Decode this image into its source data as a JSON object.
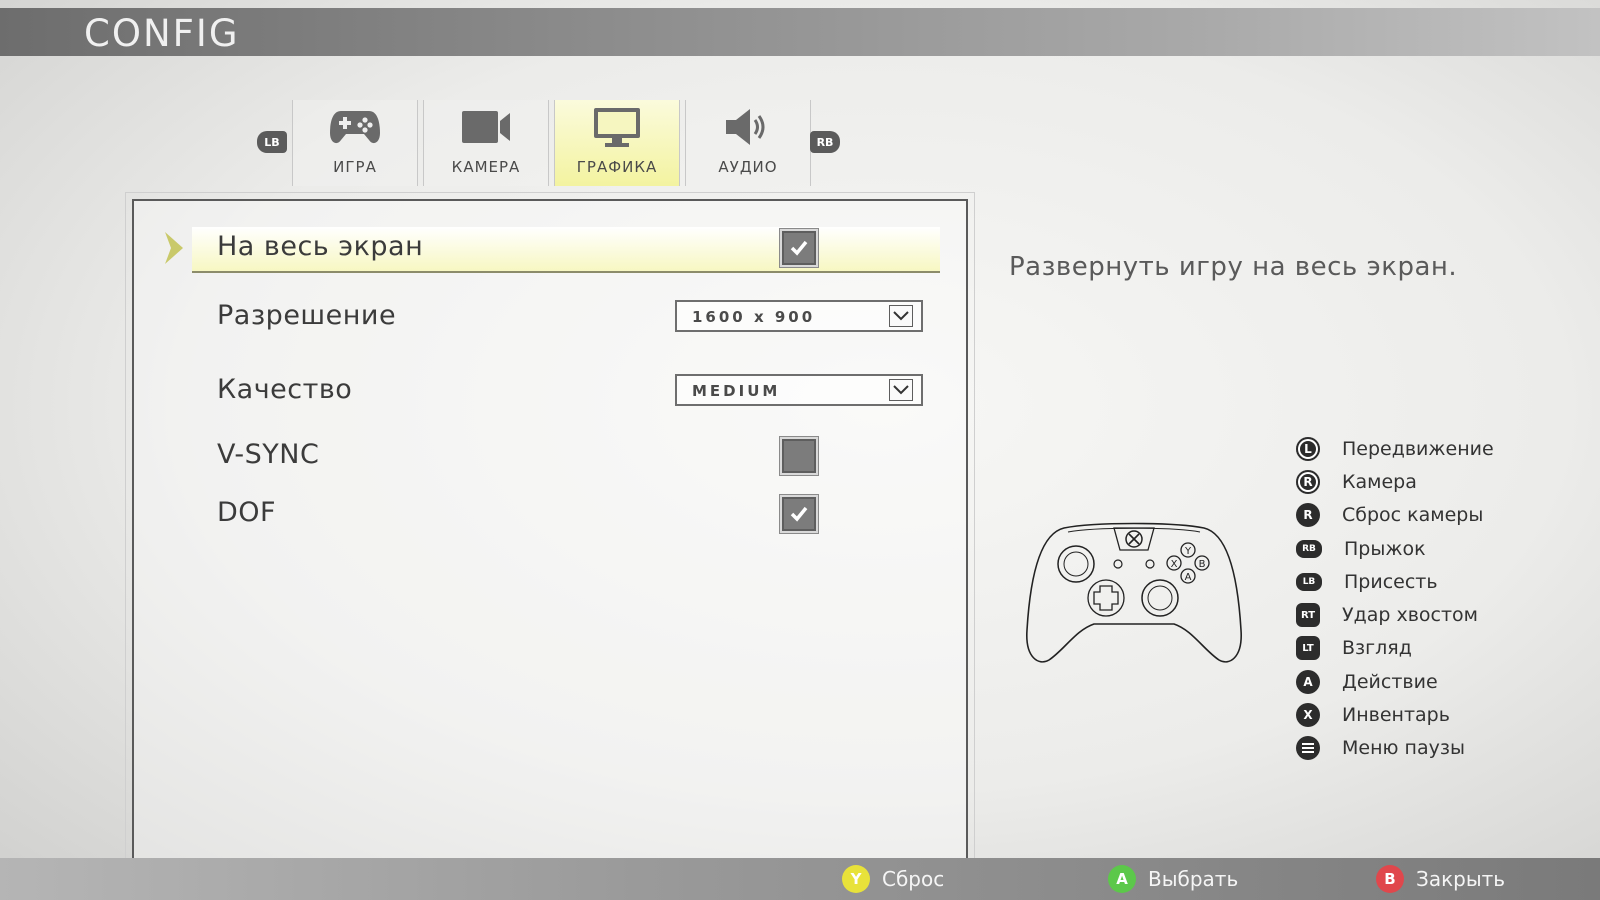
{
  "header": {
    "title": "CONFIG"
  },
  "tabs": {
    "lb": "LB",
    "rb": "RB",
    "items": [
      {
        "label": "ИГРА",
        "icon": "gamepad-icon"
      },
      {
        "label": "КАМЕРА",
        "icon": "camera-icon"
      },
      {
        "label": "ГРАФИКА",
        "icon": "monitor-icon"
      },
      {
        "label": "АУДИО",
        "icon": "speaker-icon"
      }
    ],
    "active": "ГРАФИКА"
  },
  "settings": {
    "fullscreen": {
      "label": "На весь экран",
      "checked": true
    },
    "resolution": {
      "label": "Разрешение",
      "value": "1600 x 900"
    },
    "quality": {
      "label": "Качество",
      "value": "MEDIUM"
    },
    "vsync": {
      "label": "V-SYNC",
      "checked": false
    },
    "dof": {
      "label": "DOF",
      "checked": true
    }
  },
  "description": "Развернуть игру на весь экран.",
  "controls": [
    {
      "button": "L",
      "label": "Передвижение"
    },
    {
      "button": "R",
      "label": "Камера"
    },
    {
      "button": "R",
      "label": "Сброс камеры"
    },
    {
      "button": "RB",
      "label": "Прыжок"
    },
    {
      "button": "LB",
      "label": "Присесть"
    },
    {
      "button": "RT",
      "label": "Удар хвостом"
    },
    {
      "button": "LT",
      "label": "Взгляд"
    },
    {
      "button": "A",
      "label": "Действие"
    },
    {
      "button": "X",
      "label": "Инвентарь"
    },
    {
      "button": "menu",
      "label": "Меню паузы"
    }
  ],
  "footer": {
    "reset": {
      "button": "Y",
      "label": "Сброс",
      "color": "#e8e23a"
    },
    "select": {
      "button": "A",
      "label": "Выбрать",
      "color": "#5cc84a"
    },
    "close": {
      "button": "B",
      "label": "Закрыть",
      "color": "#e0474c"
    }
  },
  "colors": {
    "accent": "#f3f3a0",
    "selectArrow": "#c9c96a"
  }
}
